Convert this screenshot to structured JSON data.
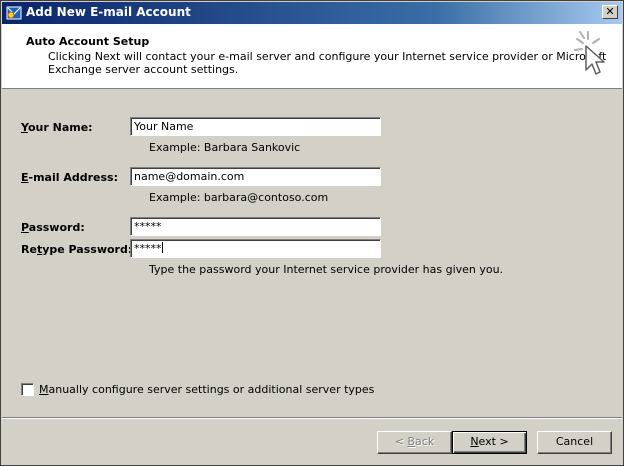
{
  "window": {
    "title": "Add New E-mail Account",
    "close_glyph": "✕"
  },
  "header": {
    "title": "Auto Account Setup",
    "description_line1": "Clicking Next will contact your e-mail server and configure your Internet service provider or Microsoft",
    "description_line2": "Exchange server account settings."
  },
  "form": {
    "name": {
      "label_prefix": "",
      "label_access_key": "Y",
      "label_rest": "our Name:",
      "value": "Your Name",
      "example": "Example: Barbara Sankovic"
    },
    "email": {
      "label_prefix": "",
      "label_access_key": "E",
      "label_rest": "-mail Address:",
      "value": "name@domain.com",
      "example": "Example: barbara@contoso.com"
    },
    "password": {
      "label_prefix": "",
      "label_access_key": "P",
      "label_rest": "assword:",
      "value": "*****"
    },
    "retype_password": {
      "label_prefix": "Re",
      "label_access_key": "t",
      "label_rest": "ype Password:",
      "value": "*****",
      "hint": "Type the password your Internet service provider has given you."
    }
  },
  "manual_config": {
    "checked": false,
    "label_access_key": "M",
    "label_rest": "anually configure server settings or additional server types"
  },
  "buttons": {
    "back": {
      "label_prefix": "< ",
      "label_access_key": "B",
      "label_rest": "ack",
      "enabled": false
    },
    "next": {
      "label_access_key": "N",
      "label_rest": "ext >",
      "enabled": true
    },
    "cancel": {
      "label": "Cancel",
      "enabled": true
    }
  },
  "colors": {
    "titlebar_start": "#0a246a",
    "titlebar_end": "#a6caf0",
    "dialog_face": "#d4d0c8",
    "header_background": "#ffffff"
  },
  "icons": {
    "title": "outlook-mail-icon",
    "header": "cursor-sparkle-icon"
  }
}
